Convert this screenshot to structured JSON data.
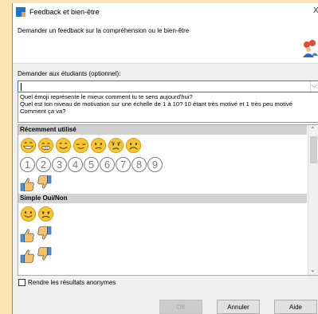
{
  "window": {
    "title": "Feedback et bien-être",
    "close_glyph": "X"
  },
  "header": {
    "text": "Demander un feedback sur la compréhension ou le bien-être"
  },
  "ask": {
    "label": "Demander aux étudiants (optionnel):",
    "value": ""
  },
  "suggestions": [
    "Quel émoji représente le mieux comment tu te sens aujourd'hui?",
    "Quel est ton niveau de motivation sur une échelle de 1 à 10? 10 étant très motivé et 1 très peu motivé",
    "Comment ça va?"
  ],
  "panel": {
    "recent_header": "Récemment utilisé",
    "recent_emojis": [
      "laughing-face",
      "grinning-face",
      "smiling-face",
      "relieved-face",
      "slightly-frowning-face",
      "worried-face",
      "frowning-face"
    ],
    "numbers": [
      "1",
      "2",
      "3",
      "4",
      "5",
      "6",
      "7",
      "8",
      "9"
    ],
    "yesno_header": "Simple Oui/Non",
    "yesno_emojis": [
      "smiling-face",
      "frowning-face"
    ]
  },
  "anonymous": {
    "label": "Rendre les résultats anonymes",
    "checked": false
  },
  "buttons": {
    "ok": "OK",
    "cancel": "Annuler",
    "help": "Aide"
  },
  "colors": {
    "emoji_fill": "#f7c531",
    "emoji_stroke": "#d39a17",
    "thumb_fill": "#f5c26b",
    "thumb_cuff": "#4a90d9",
    "accent": "#3a78c3",
    "section_header": "#d2d2d2"
  }
}
